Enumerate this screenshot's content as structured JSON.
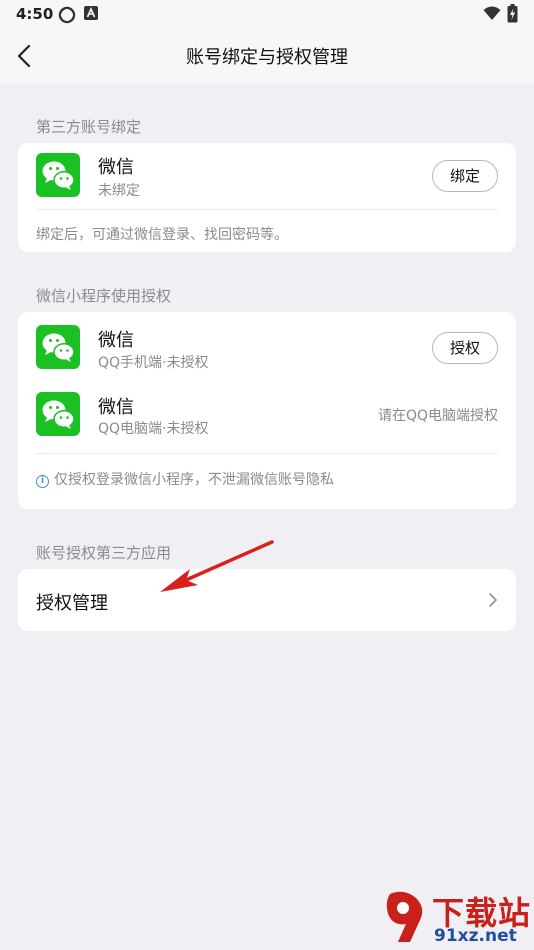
{
  "status_bar": {
    "time": "4:50"
  },
  "nav": {
    "title": "账号绑定与授权管理"
  },
  "third_party": {
    "section_title": "第三方账号绑定",
    "item": {
      "title": "微信",
      "subtitle": "未绑定",
      "button": "绑定"
    },
    "note": "绑定后，可通过微信登录、找回密码等。"
  },
  "mini_program": {
    "section_title": "微信小程序使用授权",
    "items": [
      {
        "title": "微信",
        "subtitle": "QQ手机端·未授权",
        "button": "授权"
      },
      {
        "title": "微信",
        "subtitle": "QQ电脑端·未授权",
        "hint": "请在QQ电脑端授权"
      }
    ],
    "note": "仅授权登录微信小程序，不泄漏微信账号隐私"
  },
  "third_app": {
    "section_title": "账号授权第三方应用",
    "item_label": "授权管理"
  },
  "colors": {
    "wechat_green": "#1bc123",
    "annotation_arrow": "#d8201e",
    "info_blue": "#3d8ef0"
  },
  "watermark": {
    "line1": "下载站",
    "line2": "91xz.net"
  }
}
